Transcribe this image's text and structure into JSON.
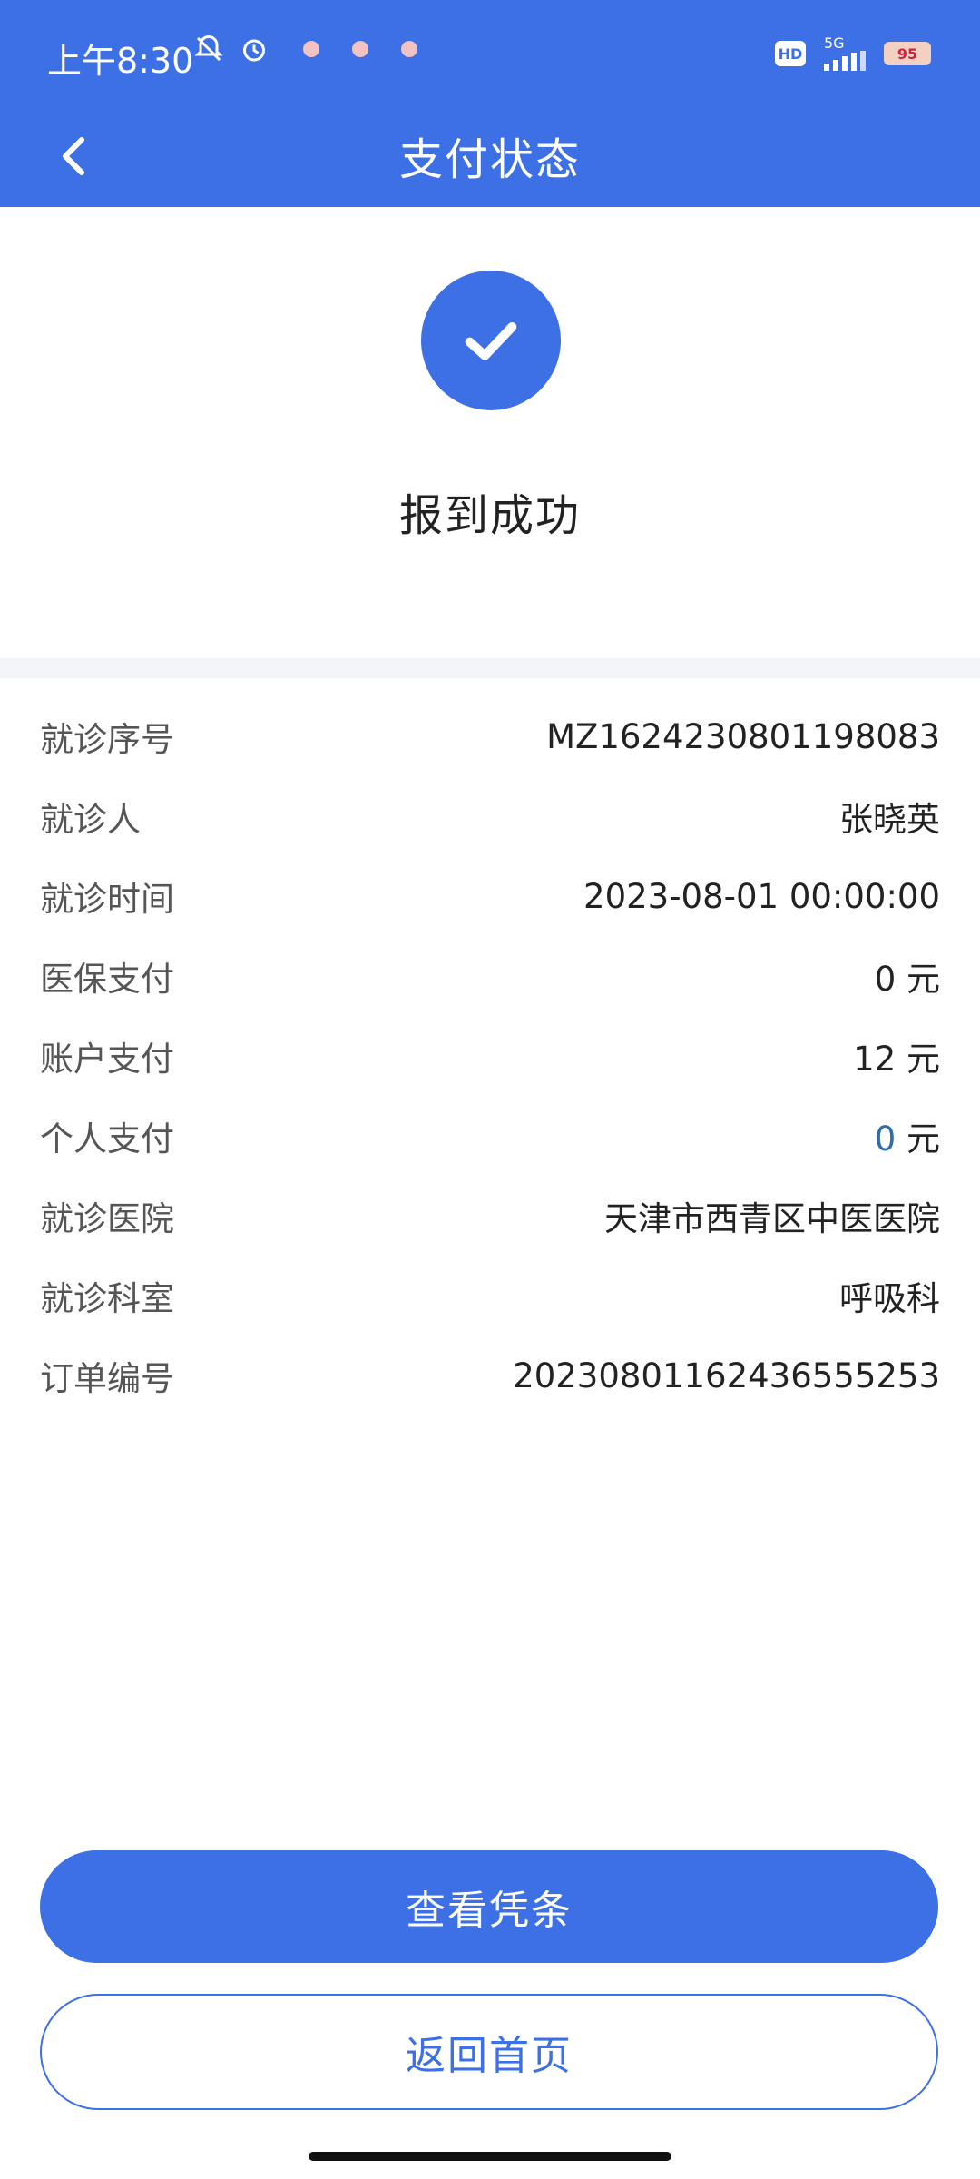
{
  "status_bar": {
    "time": "上午8:30",
    "hd_label": "HD",
    "network_label": "5G",
    "battery_label": "95"
  },
  "header": {
    "title": "支付状态",
    "back_icon": "chevron-left-icon"
  },
  "result": {
    "icon": "check-icon",
    "message": "报到成功"
  },
  "details": [
    {
      "label": "就诊序号",
      "value": "MZ1624230801198083"
    },
    {
      "label": "就诊人",
      "value": "张晓英"
    },
    {
      "label": "就诊时间",
      "value": "2023-08-01 00:00:00"
    },
    {
      "label": "医保支付",
      "value": "0 元"
    },
    {
      "label": "账户支付",
      "value": "12 元"
    },
    {
      "label": "个人支付",
      "value_number": "0",
      "value_unit": " 元"
    },
    {
      "label": "就诊医院",
      "value": "天津市西青区中医医院"
    },
    {
      "label": "就诊科室",
      "value": "呼吸科"
    },
    {
      "label": "订单编号",
      "value": "20230801162436555253"
    }
  ],
  "actions": {
    "view_receipt": "查看凭条",
    "back_home": "返回首页"
  },
  "colors": {
    "primary": "#3d70e4",
    "highlight_value": "#2d6ea8"
  }
}
